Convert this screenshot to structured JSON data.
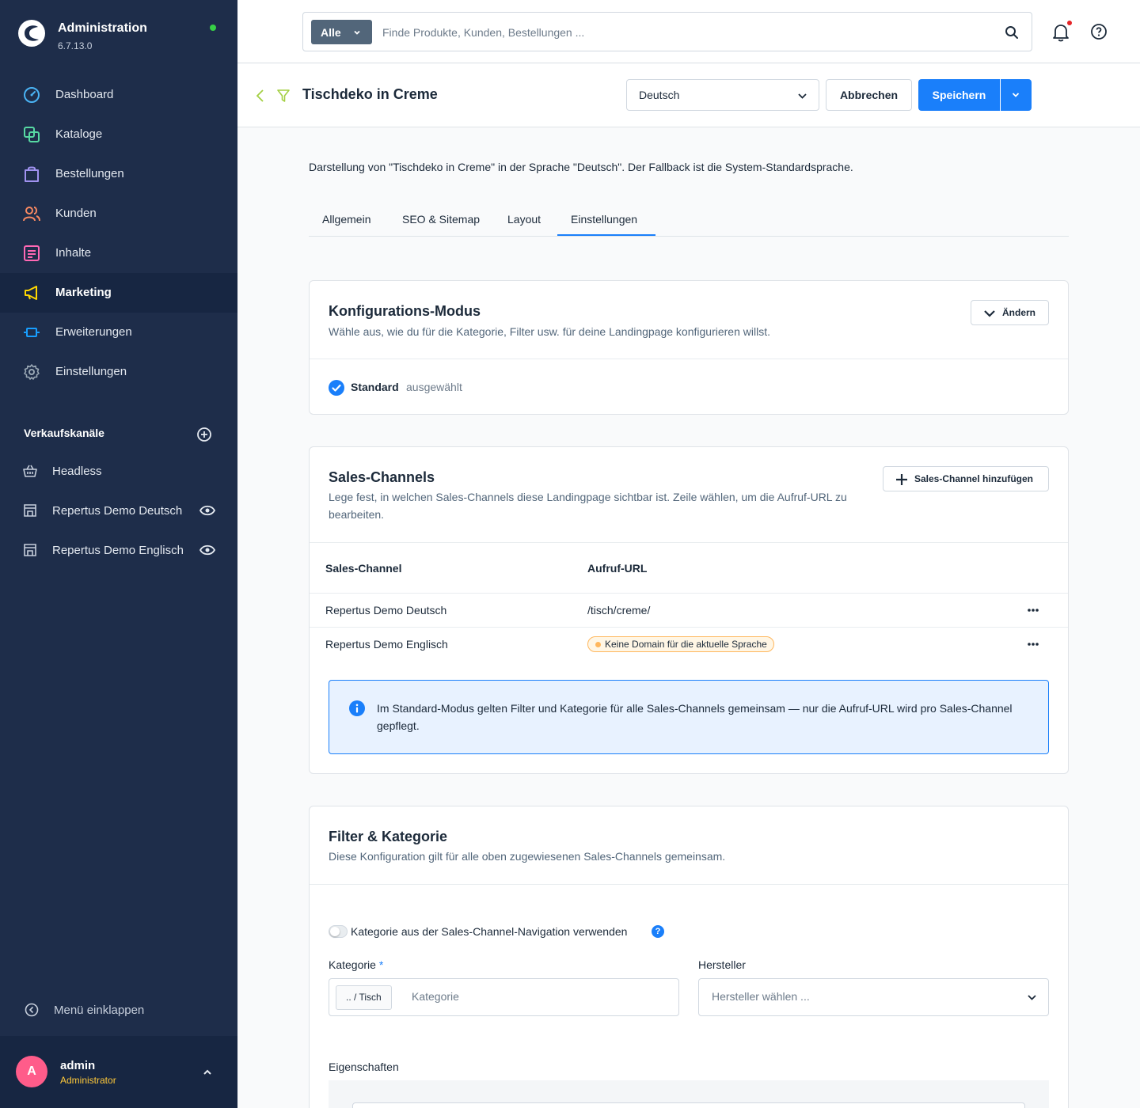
{
  "app": {
    "title": "Administration",
    "version": "6.7.13.0",
    "status_color": "#37d046"
  },
  "sidebar": {
    "items": [
      {
        "label": "Dashboard",
        "icon": "dashboard-icon",
        "color": "#4ab3f4"
      },
      {
        "label": "Kataloge",
        "icon": "catalog-icon",
        "color": "#57d9a3"
      },
      {
        "label": "Bestellungen",
        "icon": "orders-icon",
        "color": "#a092f0"
      },
      {
        "label": "Kunden",
        "icon": "customers-icon",
        "color": "#f88962"
      },
      {
        "label": "Inhalte",
        "icon": "content-icon",
        "color": "#ff68b4"
      },
      {
        "label": "Marketing",
        "icon": "marketing-icon",
        "color": "#ffd700",
        "active": true
      },
      {
        "label": "Erweiterungen",
        "icon": "extensions-icon",
        "color": "#189eff"
      },
      {
        "label": "Einstellungen",
        "icon": "settings-icon",
        "color": "#9aa8b5"
      }
    ],
    "sales_channels_heading": "Verkaufskanäle",
    "sales_channels": [
      {
        "label": "Headless",
        "icon": "basket-icon"
      },
      {
        "label": "Repertus Demo Deutsch",
        "icon": "storefront-icon"
      },
      {
        "label": "Repertus Demo Englisch",
        "icon": "storefront-icon"
      }
    ],
    "collapse_label": "Menü einklappen"
  },
  "user": {
    "initial": "A",
    "name": "admin",
    "role": "Administrator"
  },
  "search": {
    "type_label": "Alle",
    "placeholder": "Finde Produkte, Kunden, Bestellungen ..."
  },
  "page": {
    "title": "Tischdeko in Creme",
    "language": "Deutsch",
    "cancel_label": "Abbrechen",
    "save_label": "Speichern",
    "accent_color": "#1a7ffa",
    "intro": "Darstellung von \"Tischdeko in Creme\" in der Sprache \"Deutsch\". Der Fallback ist die System-Standardsprache.",
    "tabs": [
      "Allgemein",
      "SEO & Sitemap",
      "Layout",
      "Einstellungen"
    ],
    "active_tab": "Einstellungen"
  },
  "config_mode": {
    "title": "Konfigurations-Modus",
    "subtitle": "Wähle aus, wie du für die Kategorie, Filter usw. für deine Landingpage konfigurieren willst.",
    "change_label": "Ändern",
    "selected_mode": "Standard",
    "selected_status": "ausgewählt"
  },
  "sales_channels": {
    "title": "Sales-Channels",
    "subtitle": "Lege fest, in welchen Sales-Channels diese Landingpage sichtbar ist. Zeile wählen, um die Aufruf-URL zu bearbeiten.",
    "add_label": "Sales-Channel hinzufügen",
    "columns": [
      "Sales-Channel",
      "Aufruf-URL"
    ],
    "rows": [
      {
        "channel": "Repertus Demo Deutsch",
        "url": "/tisch/creme/"
      },
      {
        "channel": "Repertus Demo Englisch",
        "warning": "Keine Domain für die aktuelle Sprache"
      }
    ],
    "info": "Im Standard-Modus gelten Filter und Kategorie für alle Sales-Channels gemeinsam — nur die Aufruf-URL wird pro Sales-Channel gepflegt."
  },
  "filter_category": {
    "title": "Filter & Kategorie",
    "subtitle": "Diese Konfiguration gilt für alle oben zugewiesenen Sales-Channels gemeinsam.",
    "toggle_label": "Kategorie aus der Sales-Channel-Navigation verwenden",
    "toggle_on": false,
    "category_label": "Kategorie",
    "category_chip": ".. / Tisch",
    "category_placeholder": "Kategorie",
    "manufacturer_label": "Hersteller",
    "manufacturer_placeholder": "Hersteller wählen ...",
    "properties_label": "Eigenschaften"
  }
}
